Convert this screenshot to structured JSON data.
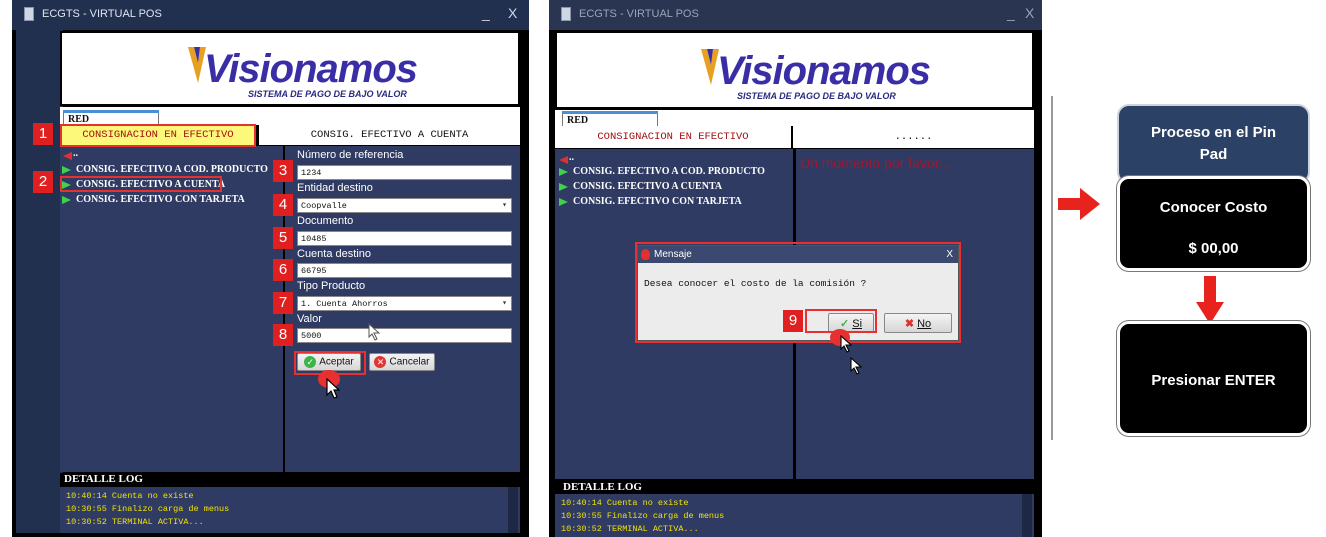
{
  "window1": {
    "title": "ECGTS - VIRTUAL POS",
    "minimize": "_",
    "close": "X",
    "logo": {
      "brand": "Visionamos",
      "tagline": "SISTEMA DE PAGO DE BAJO VALOR"
    },
    "tab_label": "RED COOPCENTRAL",
    "header_left": "CONSIGNACION EN EFECTIVO",
    "header_right": "CONSIG. EFECTIVO A CUENTA",
    "back_label": "..",
    "menu_items": [
      "CONSIG. EFECTIVO A COD. PRODUCTO",
      "CONSIG. EFECTIVO A CUENTA",
      "CONSIG. EFECTIVO CON TARJETA"
    ],
    "form": {
      "ref_label": "Número de referencia",
      "ref_value": "1234",
      "entity_label": "Entidad destino",
      "entity_value": "Coopvalle",
      "doc_label": "Documento",
      "doc_value": "10485",
      "account_label": "Cuenta destino",
      "account_value": "66795",
      "product_label": "Tipo Producto",
      "product_value": "1. Cuenta Ahorros",
      "amount_label": "Valor",
      "amount_value": "5000"
    },
    "accept_label": "Aceptar",
    "cancel_label": "Cancelar",
    "log_title": "DETALLE LOG",
    "log_lines": [
      "10:40:14 Cuenta no existe",
      "10:30:55 Finalizo carga de menus",
      "10:30:52 TERMINAL ACTIVA..."
    ]
  },
  "window2": {
    "title": "ECGTS - VIRTUAL POS",
    "minimize": "_",
    "close": "X",
    "logo": {
      "brand": "Visionamos",
      "tagline": "SISTEMA DE PAGO DE BAJO VALOR"
    },
    "tab_label": "RED COOPCENTRAL",
    "header_left": "CONSIGNACION EN EFECTIVO",
    "header_right": "......",
    "back_label": "..",
    "menu_items": [
      "CONSIG. EFECTIVO A COD. PRODUCTO",
      "CONSIG. EFECTIVO A CUENTA",
      "CONSIG. EFECTIVO CON TARJETA"
    ],
    "wait_message": "Un momento por favor...",
    "dialog": {
      "title": "Mensaje",
      "close": "X",
      "message": "Desea conocer el costo de la comisión ?",
      "yes_label": "Si",
      "no_label": "No"
    },
    "log_title": "DETALLE LOG",
    "log_lines": [
      "10:40:14 Cuenta no existe",
      "10:30:55 Finalizo carga de menus",
      "10:30:52 TERMINAL ACTIVA..."
    ]
  },
  "steps": [
    "1",
    "2",
    "3",
    "4",
    "5",
    "6",
    "7",
    "8",
    "9"
  ],
  "pinpad": {
    "header": "Proceso en el Pin Pad",
    "cost_title": "Conocer Costo",
    "cost_value": "$ 00,00",
    "press_enter": "Presionar ENTER"
  },
  "colors": {
    "panel_bg": "#2f3b63",
    "titlebar_bg": "#22304f",
    "annotation_red": "#e02020",
    "log_text": "#f2e400",
    "pinpad_header": "#2c4166",
    "pinpad_dark": "#000000"
  }
}
